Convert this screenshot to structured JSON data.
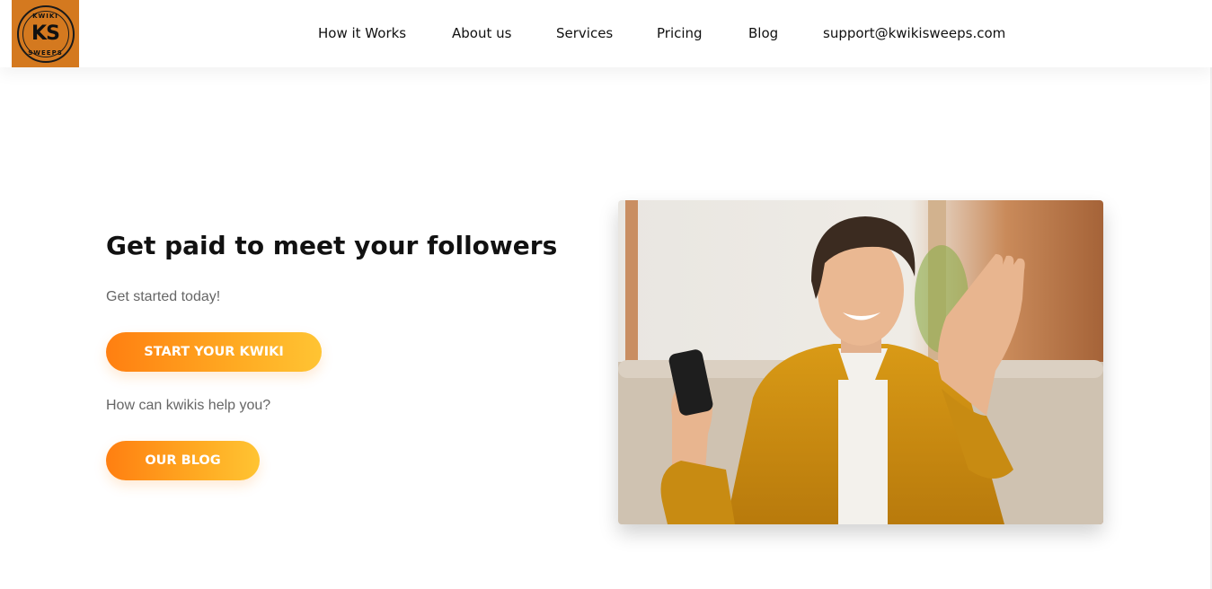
{
  "logo": {
    "top_text": "KWIKI",
    "main_text": "KS",
    "bottom_text": "SWEEPS"
  },
  "nav": {
    "items": [
      {
        "label": "How it Works"
      },
      {
        "label": "About us"
      },
      {
        "label": "Services"
      },
      {
        "label": "Pricing"
      },
      {
        "label": "Blog"
      },
      {
        "label": "support@kwikisweeps.com"
      }
    ]
  },
  "hero": {
    "title": "Get paid to meet your followers",
    "subtitle": "Get started today!",
    "primary_button": "START YOUR KWIKI",
    "help_text": "How can kwikis help you?",
    "secondary_button": "OUR BLOG"
  },
  "colors": {
    "logo_bg": "#d4791f",
    "button_gradient_start": "#ff7f11",
    "button_gradient_end": "#ffc433"
  }
}
